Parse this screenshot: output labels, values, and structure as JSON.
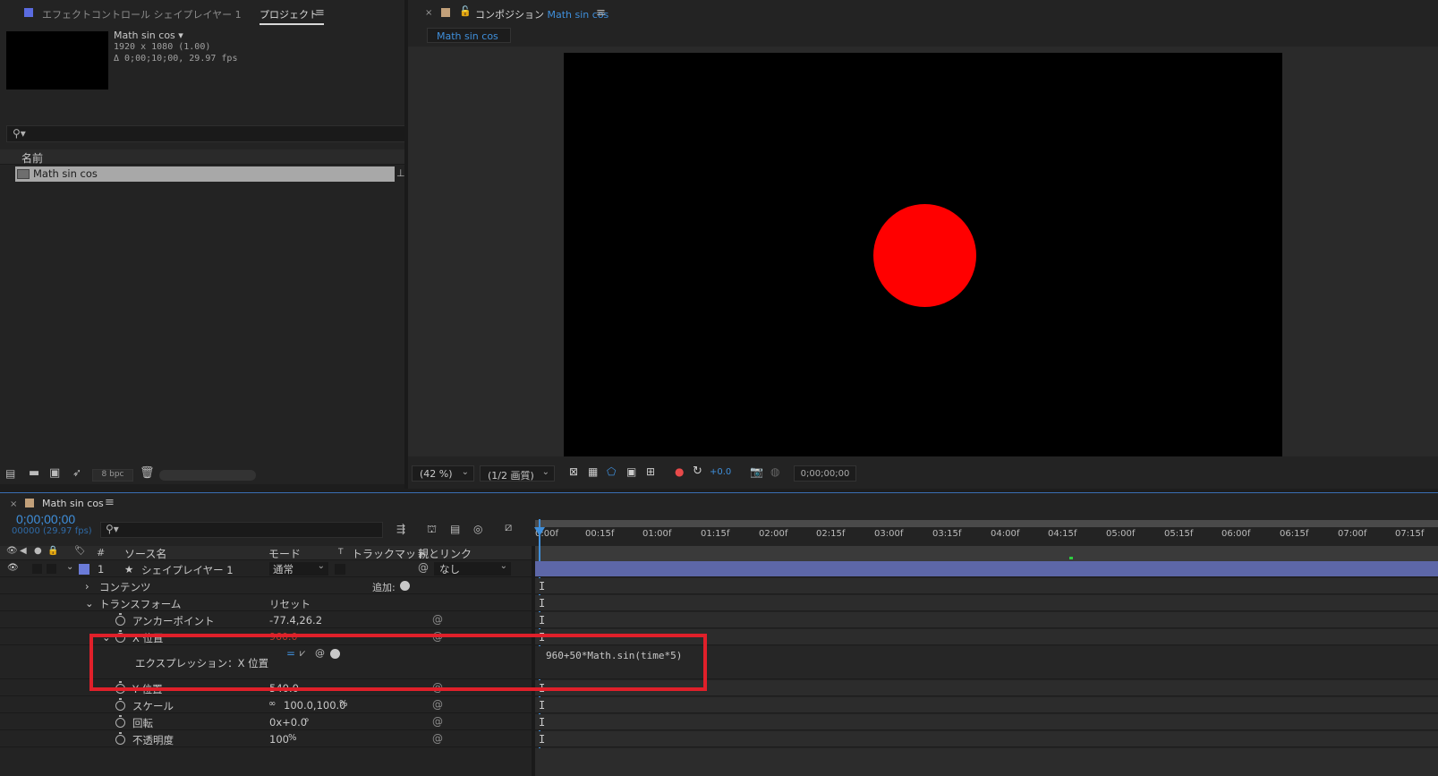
{
  "project_panel": {
    "tab_effect_control": "エフェクトコントロール シェイプレイヤー 1",
    "tab_project": "プロジェクト",
    "item_title": "Math sin cos ▾",
    "item_resolution": "1920 x 1080 (1.00)",
    "item_duration": "Δ 0;00;10;00, 29.97 fps",
    "search_placeholder": "",
    "column_name": "名前",
    "items": [
      {
        "name": "Math sin cos"
      }
    ],
    "bpc": "8 bpc"
  },
  "comp_panel": {
    "tab_label": "コンポジション",
    "tab_comp_name": "Math sin cos",
    "subtab": "Math sin cos",
    "zoom": "(42 %)",
    "resolution": "(1/2 画質)",
    "exposure": "+0.0",
    "timecode": "0;00;00;00",
    "circle_color": "#ff0000"
  },
  "timeline": {
    "tab_label": "Math sin cos",
    "timecode": "0;00;00;00",
    "frame_info": "00000 (29.97 fps)",
    "columns": {
      "hash": "#",
      "source_name": "ソース名",
      "mode": "モード",
      "t": "T",
      "trackmatte": "トラックマット",
      "parent": "親とリンク"
    },
    "ruler": [
      "0:00f",
      "00:15f",
      "01:00f",
      "01:15f",
      "02:00f",
      "02:15f",
      "03:00f",
      "03:15f",
      "04:00f",
      "04:15f",
      "05:00f",
      "05:15f",
      "06:00f",
      "06:15f",
      "07:00f",
      "07:15f"
    ],
    "layer": {
      "number": "1",
      "name": "シェイプレイヤー 1",
      "mode": "通常",
      "parent": "なし",
      "color": "#6b7bd8"
    },
    "contents_label": "コンテンツ",
    "add_label": "追加:",
    "transform_label": "トランスフォーム",
    "reset_label": "リセット",
    "props": {
      "anchor": {
        "label": "アンカーポイント",
        "value": "-77.4,26.2"
      },
      "xpos": {
        "label": "X 位置",
        "value": "960.0"
      },
      "expression": {
        "label": "エクスプレッション：X 位置",
        "code": "960+50*Math.sin(time*5)"
      },
      "ypos": {
        "label": "Y 位置",
        "value": "540.0"
      },
      "scale": {
        "label": "スケール",
        "value": "100.0,100.0",
        "unit": "%"
      },
      "rotation": {
        "label": "回転",
        "value": "0x+0.0",
        "unit": "°"
      },
      "opacity": {
        "label": "不透明度",
        "value": "100",
        "unit": "%"
      }
    },
    "highlight_color": "#e0202a"
  }
}
